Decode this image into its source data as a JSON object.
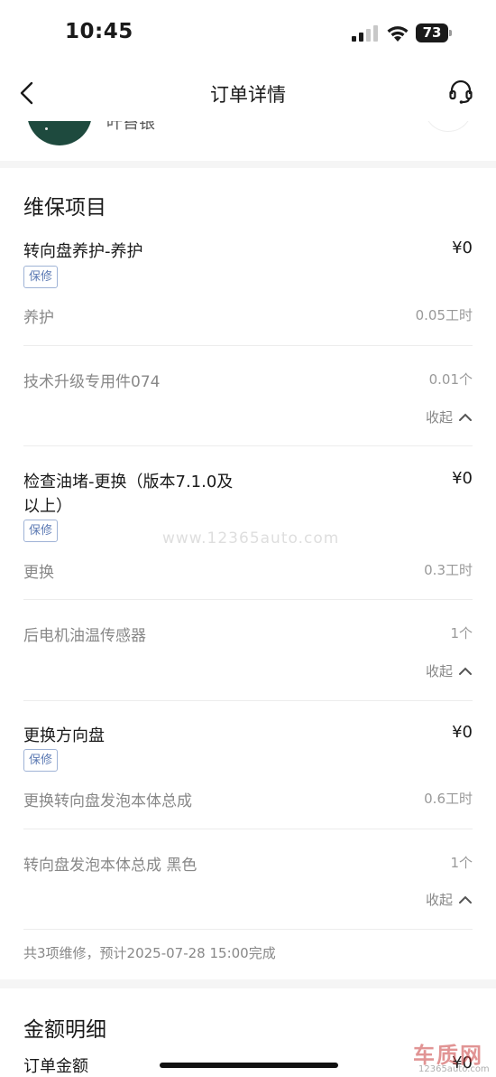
{
  "status_bar": {
    "time": "10:45",
    "battery": "73"
  },
  "nav": {
    "title": "订单详情"
  },
  "peek": {
    "name": "叶苔银"
  },
  "maintenance": {
    "title": "维保项目",
    "items": [
      {
        "name": "转向盘养护-养护",
        "price": "¥0",
        "tag": "保修",
        "labor": {
          "name": "养护",
          "qty": "0.05工时"
        },
        "part": {
          "name": "技术升级专用件074",
          "qty": "0.01个"
        },
        "collapse": "收起"
      },
      {
        "name_line1": "检查油堵-更换（版本7.1.0及",
        "name_line2": "以上）",
        "price": "¥0",
        "tag": "保修",
        "labor": {
          "name": "更换",
          "qty": "0.3工时"
        },
        "part": {
          "name": "后电机油温传感器",
          "qty": "1个"
        },
        "collapse": "收起"
      },
      {
        "name": "更换方向盘",
        "price": "¥0",
        "tag": "保修",
        "labor": {
          "name": "更换转向盘发泡本体总成",
          "qty": "0.6工时"
        },
        "part": {
          "name": "转向盘发泡本体总成 黑色",
          "qty": "1个"
        },
        "collapse": "收起"
      }
    ],
    "summary": "共3项维修，预计2025-07-28 15:00完成"
  },
  "amount": {
    "title": "金额明细",
    "order_amount_label": "订单金额",
    "order_amount_value": "¥0"
  },
  "watermark": "www.12365auto.com",
  "logo": {
    "text": "车质网",
    "sub": "12365auto.com"
  }
}
